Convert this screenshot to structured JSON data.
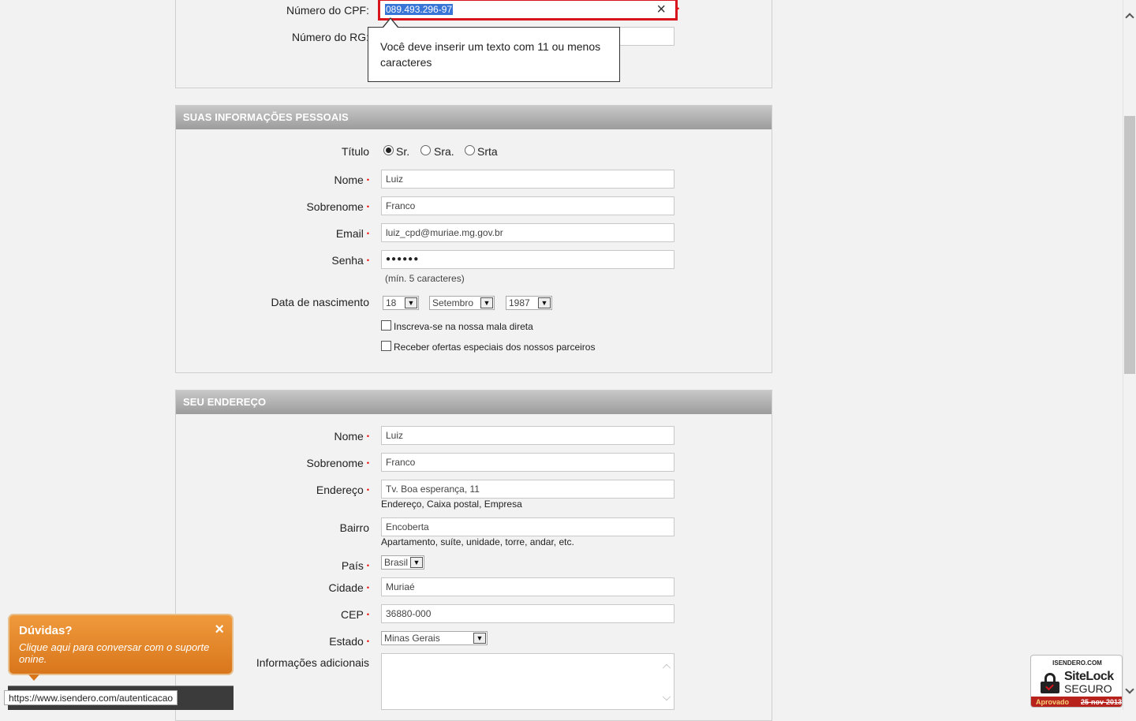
{
  "documents": {
    "cpf_label": "Número do CPF:",
    "cpf_value": "089.493.296-97",
    "rg_label": "Número do RG:",
    "clear_symbol": "×",
    "error_tooltip": "Você deve inserir um texto com 11 ou menos caracteres"
  },
  "personal": {
    "header": "SUAS INFORMAÇÕES PESSOAIS",
    "title_label": "Título",
    "title_options": [
      "Sr.",
      "Sra.",
      "Srta"
    ],
    "first_name_label": "Nome",
    "first_name": "Luiz",
    "last_name_label": "Sobrenome",
    "last_name": "Franco",
    "email_label": "Email",
    "email": "luiz_cpd@muriae.mg.gov.br",
    "password_label": "Senha",
    "password_mask": "●●●●●●",
    "password_hint": "(mín. 5 caracteres)",
    "birth_label": "Data de nascimento",
    "birth_day": "18",
    "birth_month": "Setembro",
    "birth_year": "1987",
    "newsletter_label": "Inscreva-se na nossa mala direta",
    "offers_label": "Receber ofertas especiais dos nossos parceiros"
  },
  "address": {
    "header": "SEU ENDEREÇO",
    "first_name_label": "Nome",
    "first_name": "Luiz",
    "last_name_label": "Sobrenome",
    "last_name": "Franco",
    "street_label": "Endereço",
    "street": "Tv. Boa esperança, 11",
    "street_hint": "Endereço, Caixa postal, Empresa",
    "district_label": "Bairro",
    "district": "Encoberta",
    "district_hint": "Apartamento, suíte, unidade, torre, andar, etc.",
    "country_label": "País",
    "country": "Brasil",
    "city_label": "Cidade",
    "city": "Muriaé",
    "zip_label": "CEP",
    "zip": "36880-000",
    "state_label": "Estado",
    "state": "Minas Gerais",
    "additional_label": "Informações adicionais"
  },
  "chat": {
    "title": "Dúvidas?",
    "message": "Clique aqui para conversar com o suporte onine.",
    "close_symbol": "×"
  },
  "status_url": "https://www.isendero.com/autenticacao",
  "sitelock": {
    "domain": "ISENDERO.COM",
    "brand": "SiteLock",
    "secure": "SEGURO",
    "approved": "Aprovado",
    "date": "25-nov-2013"
  }
}
